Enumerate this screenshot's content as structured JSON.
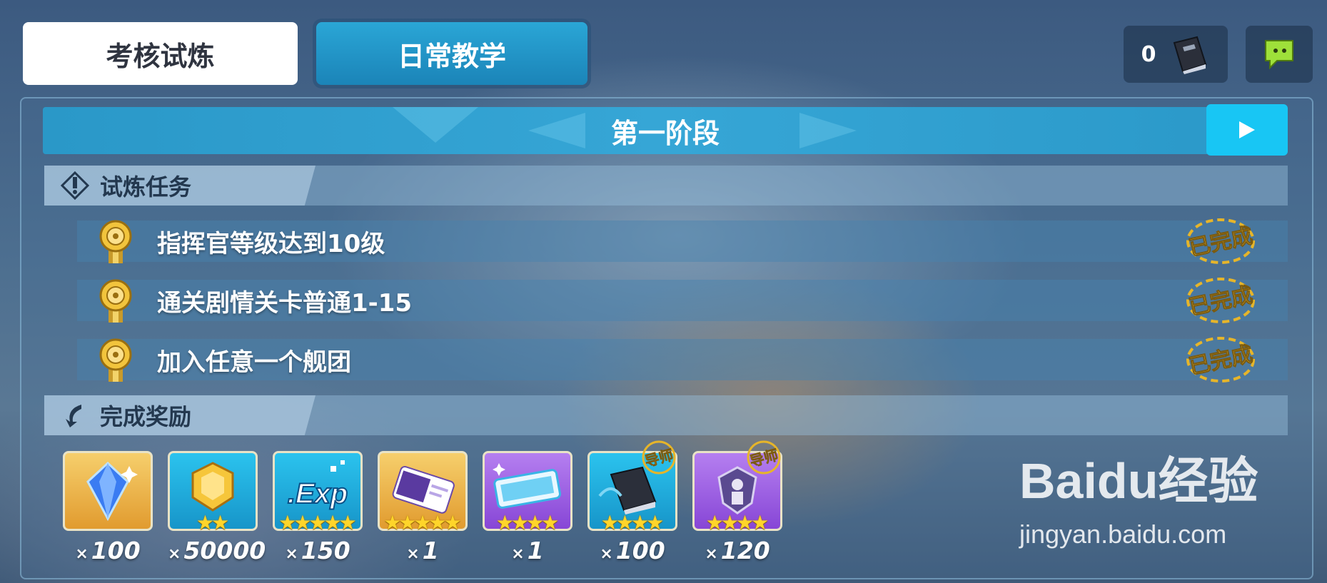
{
  "tabs": {
    "exam": "考核试炼",
    "daily": "日常教学"
  },
  "top_right": {
    "book_count": "0",
    "book_icon": "book-icon",
    "chat_icon": "chat-icon"
  },
  "stage": {
    "title": "第一阶段",
    "next_icon": "play-icon"
  },
  "tasks_section": {
    "label": "试炼任务",
    "icon": "alert-diamond-icon"
  },
  "tasks": [
    {
      "text": "指挥官等级达到10级",
      "status": "已完成"
    },
    {
      "text": "通关剧情关卡普通1-15",
      "status": "已完成"
    },
    {
      "text": "加入任意一个舰团",
      "status": "已完成"
    }
  ],
  "rewards_section": {
    "label": "完成奖励",
    "icon": "arrow-icon"
  },
  "rewards": [
    {
      "name": "crystal",
      "qty": "100",
      "stars": 0,
      "badge": ""
    },
    {
      "name": "gold-coin",
      "qty": "50000",
      "stars": 2,
      "badge": ""
    },
    {
      "name": "exp-chip",
      "qty": "150",
      "stars": 5,
      "badge": ""
    },
    {
      "name": "card",
      "qty": "1",
      "stars": 5,
      "badge": ""
    },
    {
      "name": "ticket",
      "qty": "1",
      "stars": 4,
      "badge": ""
    },
    {
      "name": "mentor-book",
      "qty": "100",
      "stars": 4,
      "badge": "导师"
    },
    {
      "name": "mentor-emblem",
      "qty": "120",
      "stars": 4,
      "badge": "导师"
    }
  ],
  "qty_prefix": "×",
  "watermark": {
    "brand": "Baidu经验",
    "url": "jingyan.baidu.com"
  },
  "colors": {
    "accent": "#18c6f4",
    "tab_active": "#1b84b8",
    "gold": "#ffd52a",
    "purple": "#9b5ae0",
    "cyan": "#1fb4e6",
    "orange": "#e9a23a"
  }
}
